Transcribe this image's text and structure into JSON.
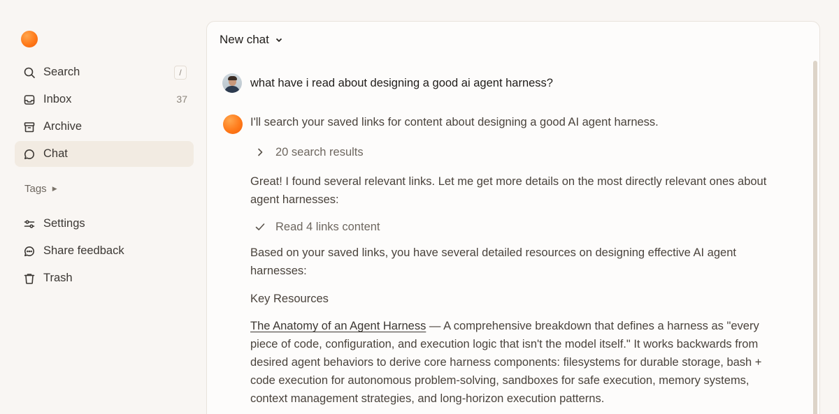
{
  "sidebar": {
    "items": [
      {
        "label": "Search",
        "icon": "search-icon",
        "shortcut": "/"
      },
      {
        "label": "Inbox",
        "icon": "inbox-icon",
        "count": "37"
      },
      {
        "label": "Archive",
        "icon": "archive-icon"
      },
      {
        "label": "Chat",
        "icon": "chat-icon",
        "active": true
      }
    ],
    "tags_label": "Tags",
    "bottom_items": [
      {
        "label": "Settings",
        "icon": "sliders-icon"
      },
      {
        "label": "Share feedback",
        "icon": "feedback-icon"
      },
      {
        "label": "Trash",
        "icon": "trash-icon"
      }
    ]
  },
  "chat": {
    "title": "New chat",
    "user_message": "what have i read about designing a good ai agent harness?",
    "assistant": {
      "intro": "I'll search your saved links for content about designing a good AI agent harness.",
      "step1": "20 search results",
      "para1": "Great! I found several relevant links. Let me get more details on the most directly relevant ones about agent harnesses:",
      "step2": "Read 4 links content",
      "para2": "Based on your saved links, you have several detailed resources on designing effective AI agent harnesses:",
      "heading": "Key Resources",
      "link_title": "The Anatomy of an Agent Harness",
      "link_desc": " — A comprehensive breakdown that defines a harness as \"every piece of code, configuration, and execution logic that isn't the model itself.\" It works backwards from desired agent behaviors to derive core harness components: filesystems for durable storage, bash + code execution for autonomous problem-solving, sandboxes for safe execution, memory systems, context management strategies, and long-horizon execution patterns."
    }
  },
  "colors": {
    "accent_orange": "#ff7a1a",
    "active_bg": "#f2ebe2",
    "background": "#f9f6f3"
  }
}
